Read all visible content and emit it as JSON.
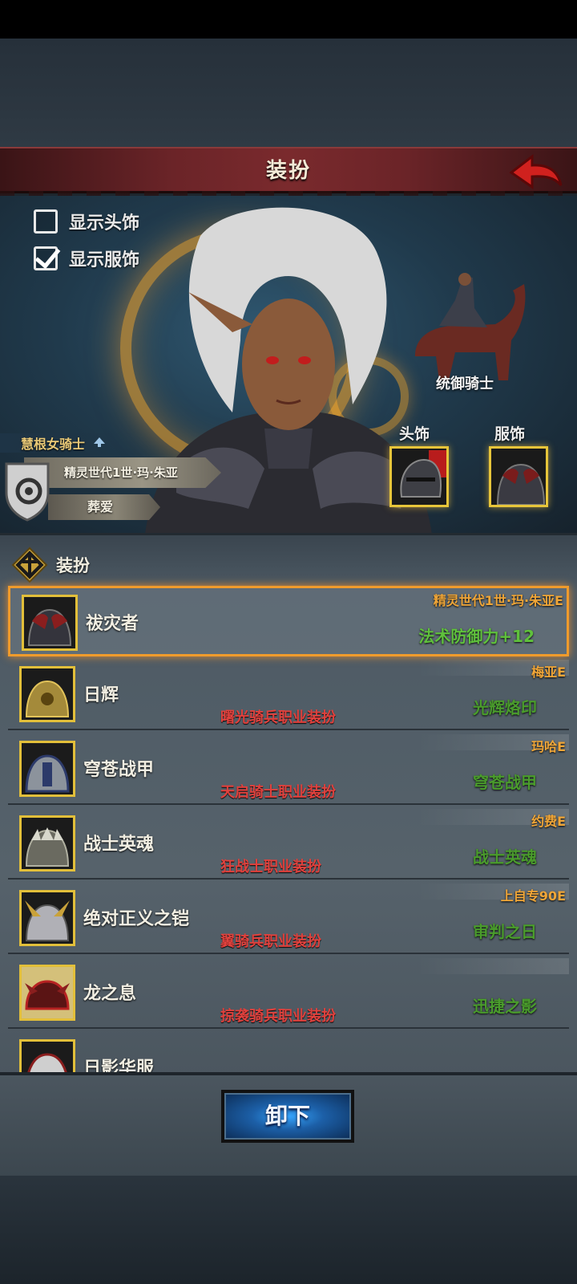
{
  "header": {
    "title": "装扮"
  },
  "options": {
    "show_headwear": {
      "label": "显示头饰",
      "checked": false
    },
    "show_outfit": {
      "label": "显示服饰",
      "checked": true
    }
  },
  "mount": {
    "label": "统御骑士"
  },
  "slots": {
    "headwear_label": "头饰",
    "outfit_label": "服饰"
  },
  "character": {
    "title": "慧根女骑士",
    "name": "精灵世代1世·玛·朱亚",
    "status": "葬爱"
  },
  "section": {
    "title": "装扮"
  },
  "items": [
    {
      "name": "祓灾者",
      "owner": "精灵世代1世·玛·朱亚E",
      "effect": "法术防御力+12",
      "class": "",
      "selected": true
    },
    {
      "name": "日辉",
      "owner": "梅亚E",
      "effect": "光辉烙印",
      "class": "曙光骑兵职业装扮",
      "selected": false
    },
    {
      "name": "穹苍战甲",
      "owner": "玛哈E",
      "effect": "穹苍战甲",
      "class": "天启骑士职业装扮",
      "selected": false
    },
    {
      "name": "战士英魂",
      "owner": "约费E",
      "effect": "战士英魂",
      "class": "狂战士职业装扮",
      "selected": false
    },
    {
      "name": "绝对正义之铠",
      "owner": "上自专90E",
      "effect": "审判之日",
      "class": "翼骑兵职业装扮",
      "selected": false
    },
    {
      "name": "龙之息",
      "owner": "",
      "effect": "迅捷之影",
      "class": "掠袭骑兵职业装扮",
      "selected": false
    },
    {
      "name": "日影华服",
      "owner": "",
      "effect": "",
      "class": "",
      "selected": false
    }
  ],
  "footer": {
    "unequip_label": "卸下"
  },
  "colors": {
    "accent": "#ef9b2c",
    "effect_green": "#5fc13c",
    "class_red": "#e0413d",
    "owner_orange": "#f0a638"
  }
}
